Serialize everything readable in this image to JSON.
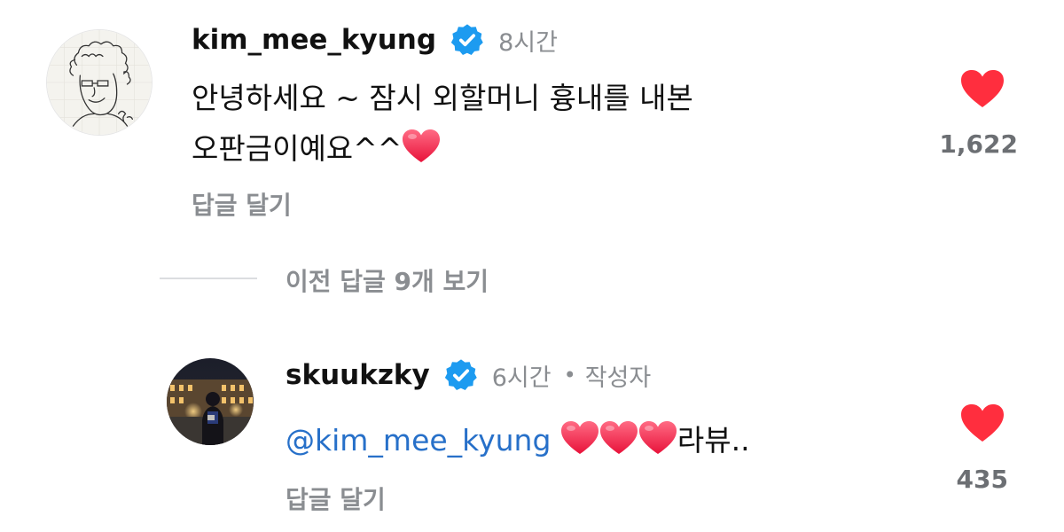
{
  "colors": {
    "heart_red": "#ff2e3e",
    "verified_blue": "#1d9bf0",
    "mention_blue": "#2770c9",
    "muted_gray": "#8a8d91"
  },
  "comments": [
    {
      "username": "kim_mee_kyung",
      "verified": true,
      "time": "8시간",
      "body_line1": "안녕하세요 ~  잠시 외할머니 흉내를 내본",
      "body_line2": "오판금이예요^^",
      "body_emoji": "heart",
      "reply_label": "답글 달기",
      "likes": "1,622",
      "like_icon": "heart-filled-icon",
      "avatar": "sketch-drawing-avatar"
    },
    {
      "username": "skuukzky",
      "verified": true,
      "time": "6시간",
      "separator": "•",
      "author_badge": "작성자",
      "mention": "@kim_mee_kyung",
      "body_emoji_count": 3,
      "body_text": "라뷰..",
      "reply_label": "답글 달기",
      "likes": "435",
      "like_icon": "heart-filled-icon",
      "avatar": "night-city-photo-avatar"
    }
  ],
  "replies_toggle": {
    "label": "이전 답글 9개 보기"
  }
}
